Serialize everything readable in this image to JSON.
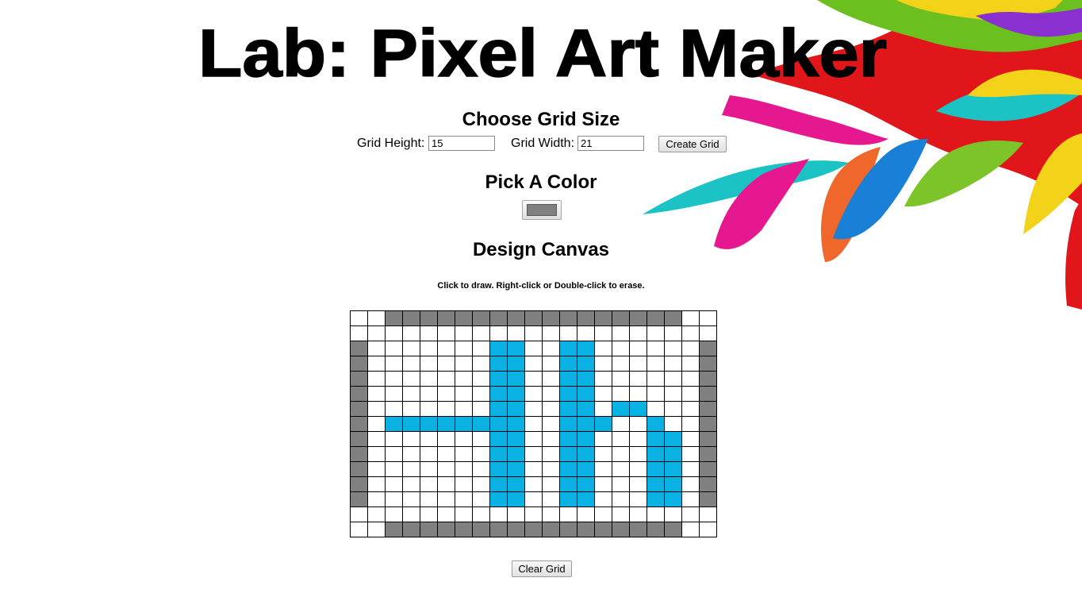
{
  "title": "Lab: Pixel Art Maker",
  "grid_size": {
    "heading": "Choose Grid Size",
    "height_label": "Grid Height:",
    "height_value": "15",
    "width_label": "Grid Width:",
    "width_value": "21",
    "create_button": "Create Grid"
  },
  "color": {
    "heading": "Pick A Color",
    "value": "#808080"
  },
  "canvas": {
    "heading": "Design Canvas",
    "instructions": "Click to draw. Right-click or Double-click to erase.",
    "clear_button": "Clear Grid",
    "palette": {
      "W": "#ffffff",
      "G": "#808080",
      "B": "#0ab1e3"
    },
    "rows": [
      "WWGGGGGGGGGGGGGGGGGWW",
      "WWWWWWWWWWWWWWWWWWWWW",
      "GWWWWWWWBBWWBBWWWWWWG",
      "GWWWWWWWBBWWBBWWWWWWG",
      "GWWWWWWWBBWWBBWWWWWWG",
      "GWWWWWWWBBWWBBWWWWWWG",
      "GWWWWWWWBBWWBBWBBWWWG",
      "GWBBBBBBBBWWBBBWWBWWG",
      "GWWWWWWWBBWWBBWWWBBWG",
      "GWWWWWWWBBWWBBWWWBBWG",
      "GWWWWWWWBBWWBBWWWBBWG",
      "GWWWWWWWBBWWBBWWWBBWG",
      "GWWWWWWWBBWWBBWWWBBWG",
      "WWWWWWWWWWWWWWWWWWWWW",
      "WWGGGGGGGGGGGGGGGGGWW"
    ]
  }
}
